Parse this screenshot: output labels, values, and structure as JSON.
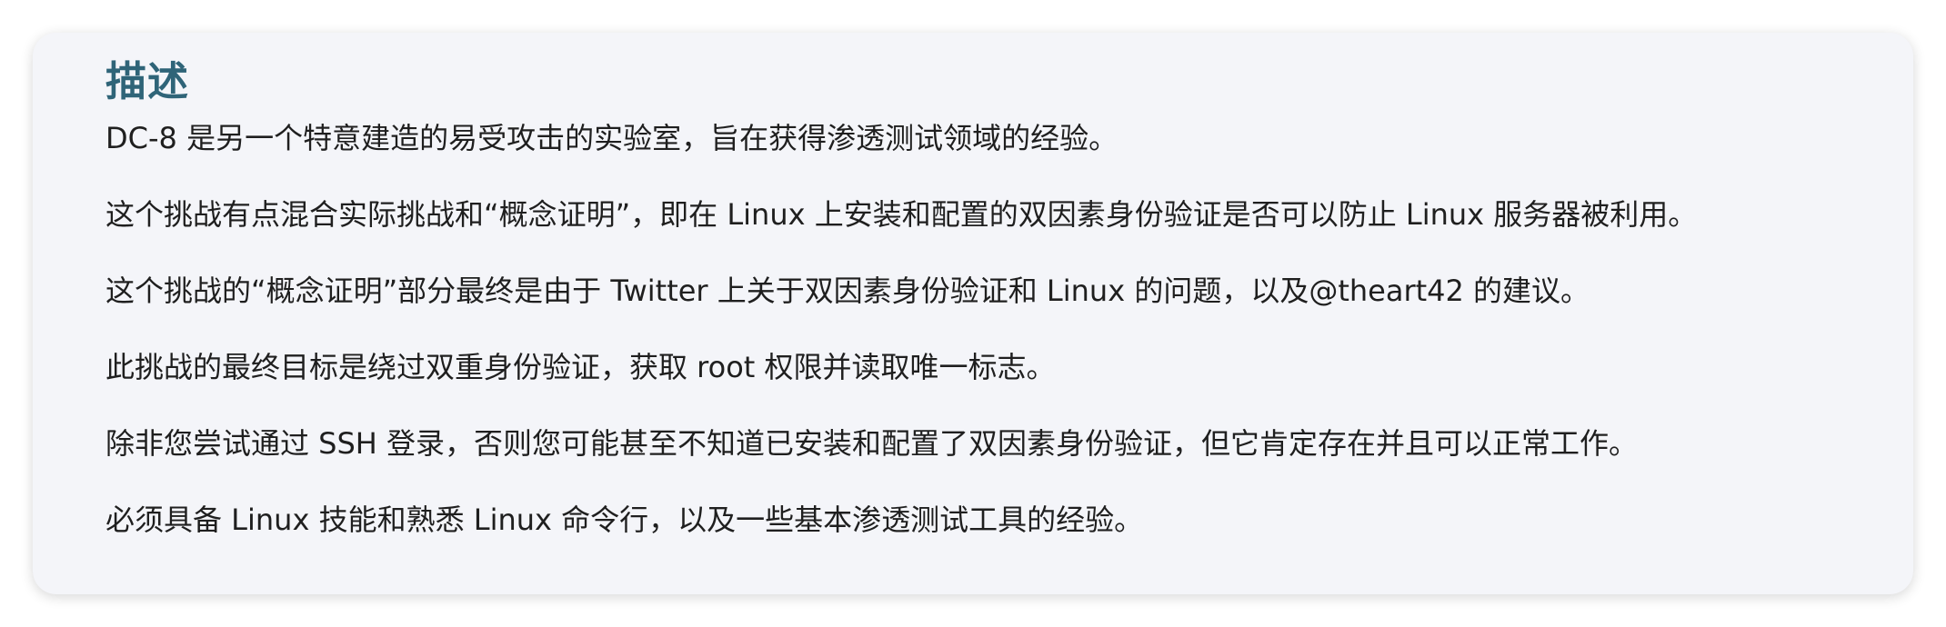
{
  "section": {
    "title": "描述",
    "paragraphs": [
      "DC-8 是另一个特意建造的易受攻击的实验室，旨在获得渗透测试领域的经验。",
      "这个挑战有点混合实际挑战和“概念证明”，即在 Linux 上安装和配置的双因素身份验证是否可以防止 Linux 服务器被利用。",
      "这个挑战的“概念证明”部分最终是由于 Twitter 上关于双因素身份验证和 Linux 的问题，以及@theart42 的建议。",
      "此挑战的最终目标是绕过双重身份验证，获取 root 权限并读取唯一标志。",
      "除非您尝试通过 SSH 登录，否则您可能甚至不知道已安装和配置了双因素身份验证，但它肯定存在并且可以正常工作。",
      "必须具备 Linux 技能和熟悉 Linux 命令行，以及一些基本渗透测试工具的经验。"
    ]
  },
  "colors": {
    "heading": "#2f6478",
    "text": "#1f1f1f",
    "card_background": "#f4f5f9"
  }
}
